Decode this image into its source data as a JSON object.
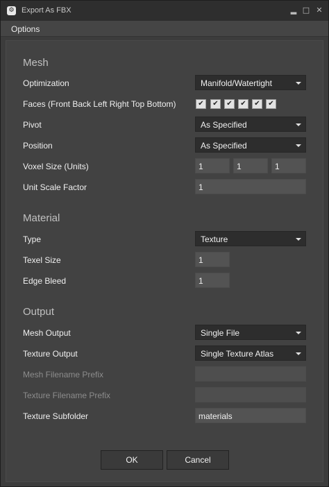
{
  "window": {
    "app_icon": "app-logo-icon",
    "title": "Export As FBX",
    "minimize_glyph": "▂",
    "maximize_glyph": "□",
    "close_glyph": "✕"
  },
  "menu": {
    "options": "Options"
  },
  "mesh": {
    "heading": "Mesh",
    "optimization": {
      "label": "Optimization",
      "value": "Manifold/Watertight"
    },
    "faces": {
      "label": "Faces (Front Back Left Right Top Bottom)",
      "checked": [
        true,
        true,
        true,
        true,
        true,
        true
      ]
    },
    "pivot": {
      "label": "Pivot",
      "value": "As Specified"
    },
    "position": {
      "label": "Position",
      "value": "As Specified"
    },
    "voxel_size": {
      "label": "Voxel Size (Units)",
      "x": "1",
      "y": "1",
      "z": "1"
    },
    "unit_scale": {
      "label": "Unit Scale Factor",
      "value": "1"
    }
  },
  "material": {
    "heading": "Material",
    "type": {
      "label": "Type",
      "value": "Texture"
    },
    "texel_size": {
      "label": "Texel Size",
      "value": "1"
    },
    "edge_bleed": {
      "label": "Edge Bleed",
      "value": "1"
    }
  },
  "output": {
    "heading": "Output",
    "mesh_output": {
      "label": "Mesh Output",
      "value": "Single File"
    },
    "texture_output": {
      "label": "Texture Output",
      "value": "Single Texture Atlas"
    },
    "mesh_prefix": {
      "label": "Mesh Filename Prefix",
      "value": ""
    },
    "texture_prefix": {
      "label": "Texture Filename Prefix",
      "value": ""
    },
    "texture_subfolder": {
      "label": "Texture Subfolder",
      "value": "materials"
    }
  },
  "buttons": {
    "ok": "OK",
    "cancel": "Cancel"
  },
  "check_glyph": "✔"
}
